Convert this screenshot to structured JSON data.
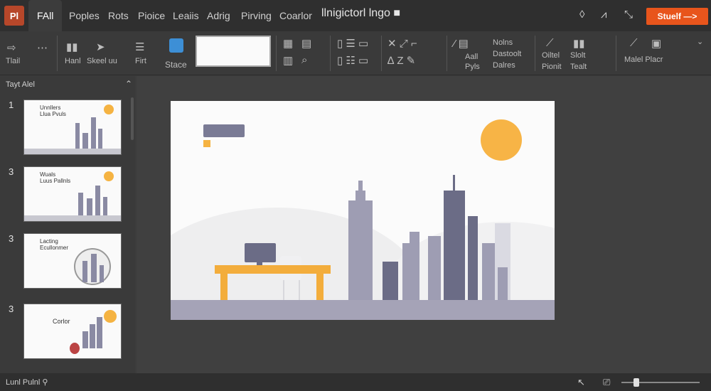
{
  "app": {
    "logo_text": "Pl",
    "doc_title": "llnigictorl lngo",
    "share_label": "Stuelf —>"
  },
  "tabs": [
    {
      "label": "FAll",
      "active": true
    },
    {
      "label": "Poples"
    },
    {
      "label": "Rots"
    },
    {
      "label": "Pioice"
    },
    {
      "label": "Leaiis"
    },
    {
      "label": "Adrig"
    },
    {
      "label": "Pirving"
    },
    {
      "label": "Coarlor"
    }
  ],
  "ribbon": {
    "items": [
      {
        "label": "Tlail"
      },
      {
        "label": "Hanl"
      },
      {
        "label": "Skeel uu"
      },
      {
        "label": "Firt"
      },
      {
        "label": "Stace"
      },
      {
        "label": "Aall"
      },
      {
        "label": "Pyls"
      },
      {
        "label": "Nolns"
      },
      {
        "label": "Dastoolt"
      },
      {
        "label": "Dalres"
      },
      {
        "label": "Oiltel"
      },
      {
        "label": "Pionit"
      },
      {
        "label": "Slolt"
      },
      {
        "label": "Tealt"
      },
      {
        "label": "Malel Placr"
      }
    ]
  },
  "panel": {
    "header": "Tayt Alel",
    "slides": [
      {
        "number": "1",
        "title": "Unnllers\nLlua Pvuls"
      },
      {
        "number": "3",
        "title": "Wuals\nLuus Pallnls"
      },
      {
        "number": "3",
        "title": "Lacting\nEcullonmer"
      },
      {
        "number": "3",
        "title": "Corlor"
      }
    ]
  },
  "status": {
    "text": "Lunl Pulnl"
  },
  "colors": {
    "accent": "#e8551c",
    "sun": "#f7b446",
    "building": "#8a8aa3",
    "desk": "#f3ad3c",
    "floor": "#a5a3b7"
  },
  "icons": [
    "arrow-right-icon",
    "grid-icon",
    "cursor-icon",
    "text-icon",
    "shape-icon",
    "table-icon",
    "line-icon",
    "brush-icon",
    "search-icon",
    "zoom-icon",
    "fit-icon"
  ]
}
